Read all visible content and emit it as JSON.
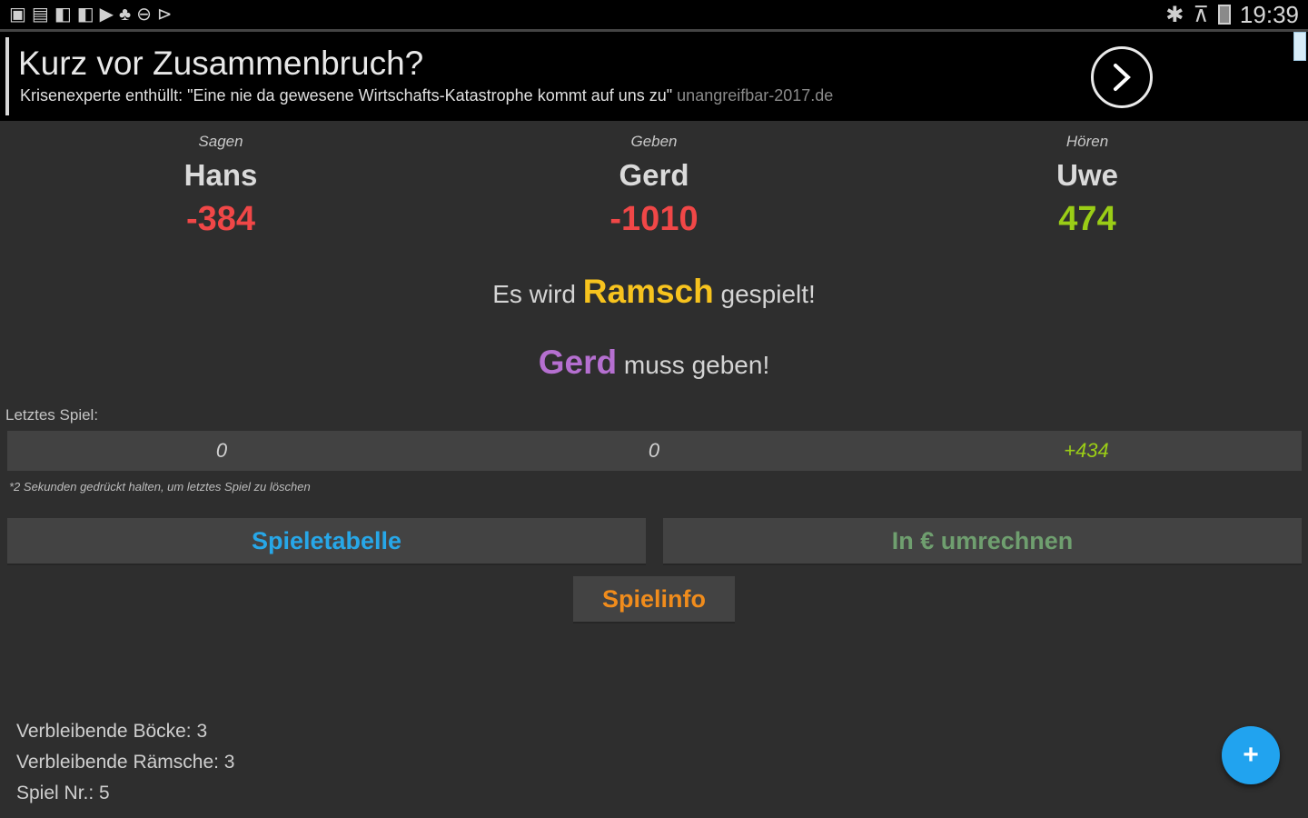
{
  "status_bar": {
    "left_icons": [
      "notification-1-icon",
      "gallery-icon",
      "app-f1-icon",
      "app-f2-icon",
      "play-store-icon",
      "alarm-icon",
      "dnd-icon",
      "media-icon"
    ],
    "right_icons": [
      "bluetooth-icon",
      "wifi-icon",
      "battery-icon"
    ],
    "time": "19:39"
  },
  "ad": {
    "title": "Kurz vor Zusammenbruch?",
    "text": "Krisenexperte enthüllt: \"Eine nie da gewesene Wirtschafts-Katastrophe kommt auf uns zu\"",
    "url": "unangreifbar-2017.de"
  },
  "players": [
    {
      "role": "Sagen",
      "name": "Hans",
      "score": "-384",
      "score_color": "#f04747"
    },
    {
      "role": "Geben",
      "name": "Gerd",
      "score": "-1010",
      "score_color": "#f04747"
    },
    {
      "role": "Hören",
      "name": "Uwe",
      "score": "474",
      "score_color": "#9acd16"
    }
  ],
  "message_game": {
    "prefix": "Es wird",
    "highlight": "Ramsch",
    "suffix": "gespielt!"
  },
  "message_dealer": {
    "highlight": "Gerd",
    "suffix": "muss geben!"
  },
  "last_game": {
    "label": "Letztes Spiel:",
    "values": [
      {
        "text": "0",
        "color": "#d2d2d2"
      },
      {
        "text": "0",
        "color": "#d2d2d2"
      },
      {
        "text": "+434",
        "color": "#9acd16"
      }
    ],
    "hint": "*2 Sekunden gedrückt halten, um letztes Spiel zu löschen"
  },
  "buttons": {
    "table": {
      "label": "Spieletabelle",
      "color": "#27a7e8"
    },
    "convert": {
      "label": "In € umrechnen",
      "color": "#6f9f6f"
    },
    "info": {
      "label": "Spielinfo",
      "color": "#f08c1c"
    }
  },
  "stats": {
    "boecke": "Verbleibende Böcke: 3",
    "raemsche": "Verbleibende Rämsche: 3",
    "spiel_nr": "Spiel Nr.: 5"
  },
  "fab": {
    "label": "+"
  }
}
